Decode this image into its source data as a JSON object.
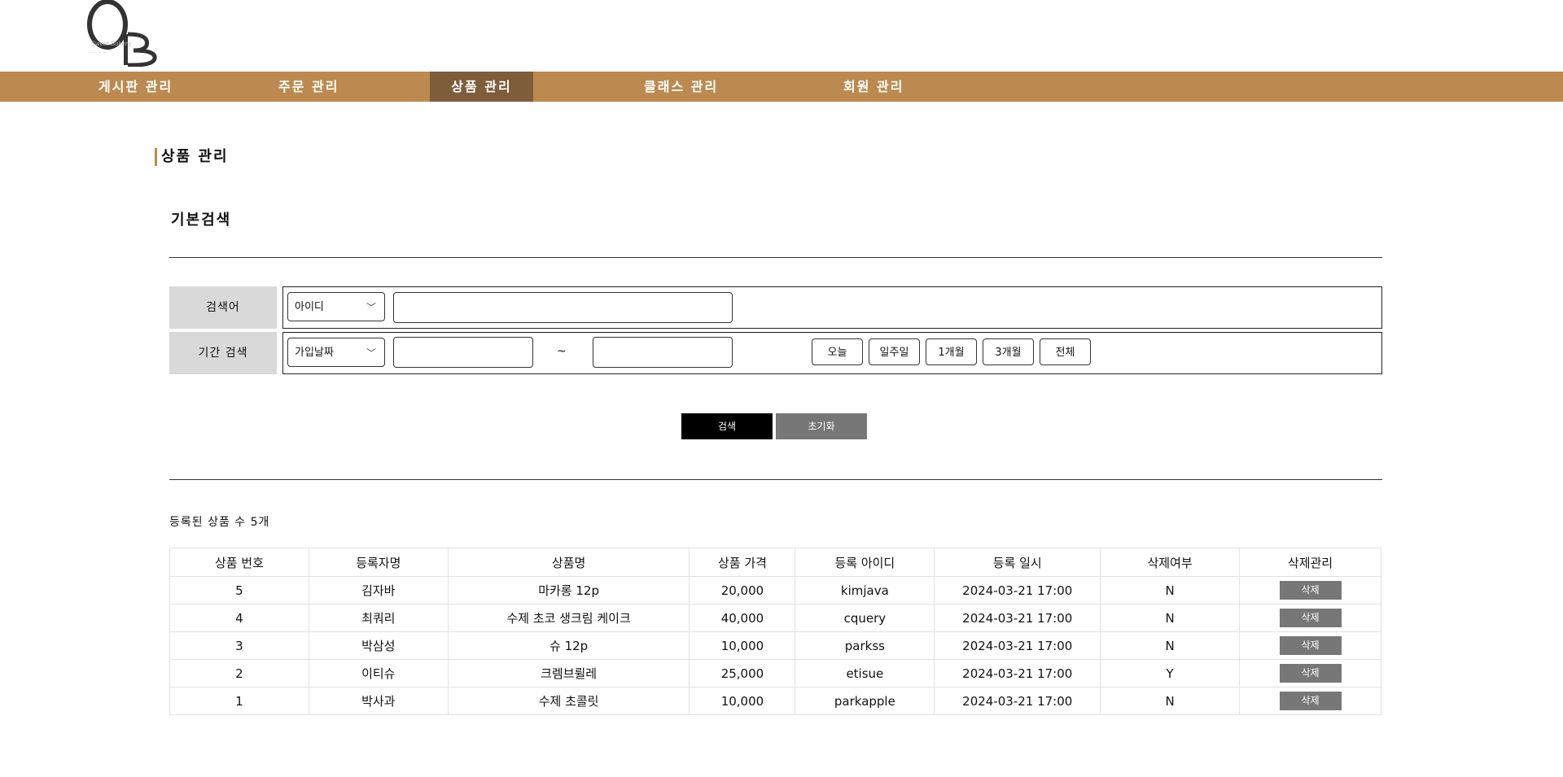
{
  "logo": {
    "text": "OB",
    "icon": "ob-logo-icon"
  },
  "nav": {
    "items": [
      {
        "label": "게시판 관리"
      },
      {
        "label": "주문 관리"
      },
      {
        "label": "상품 관리"
      },
      {
        "label": "클래스 관리"
      },
      {
        "label": "회원 관리"
      }
    ],
    "active_index": 2
  },
  "page": {
    "title": "상품 관리"
  },
  "search": {
    "section_title": "기본검색",
    "keyword_label": "검색어",
    "keyword_select_value": "아이디",
    "keyword_value": "",
    "period_label": "기간 검색",
    "period_select_value": "가입날짜",
    "date_from": "",
    "tilde": "~",
    "date_to": "",
    "period_buttons": [
      "오늘",
      "일주일",
      "1개월",
      "3개월",
      "전체"
    ],
    "search_button": "검색",
    "reset_button": "초기화"
  },
  "colors": {
    "nav_bg": "#bc8a50",
    "nav_active_bg": "#7e5d3b",
    "search_button_bg": "#000000",
    "reset_button_bg": "#777777",
    "delete_button_bg": "#777777",
    "label_cell_bg": "#d9d9d9"
  },
  "results": {
    "count_text": "등록된 상품 수 5개",
    "columns": [
      "상품 번호",
      "등록자명",
      "상품명",
      "상품 가격",
      "등록 아이디",
      "등록 일시",
      "삭제여부",
      "삭제관리"
    ],
    "rows": [
      {
        "no": "5",
        "registrant": "김자바",
        "product": "마카롱 12p",
        "price": "20,000",
        "user_id": "kimjava",
        "date": "2024-03-21 17:00",
        "deleted": "N",
        "action": "삭제"
      },
      {
        "no": "4",
        "registrant": "최쿼리",
        "product": "수제 초코 생크림 케이크",
        "price": "40,000",
        "user_id": "cquery",
        "date": "2024-03-21 17:00",
        "deleted": "N",
        "action": "삭제"
      },
      {
        "no": "3",
        "registrant": "박삼성",
        "product": "슈 12p",
        "price": "10,000",
        "user_id": "parkss",
        "date": "2024-03-21 17:00",
        "deleted": "N",
        "action": "삭제"
      },
      {
        "no": "2",
        "registrant": "이티슈",
        "product": "크렘브륄레",
        "price": "25,000",
        "user_id": "etisue",
        "date": "2024-03-21 17:00",
        "deleted": "Y",
        "action": "삭제"
      },
      {
        "no": "1",
        "registrant": "박사과",
        "product": "수제 초콜릿",
        "price": "10,000",
        "user_id": "parkapple",
        "date": "2024-03-21 17:00",
        "deleted": "N",
        "action": "삭제"
      }
    ]
  }
}
